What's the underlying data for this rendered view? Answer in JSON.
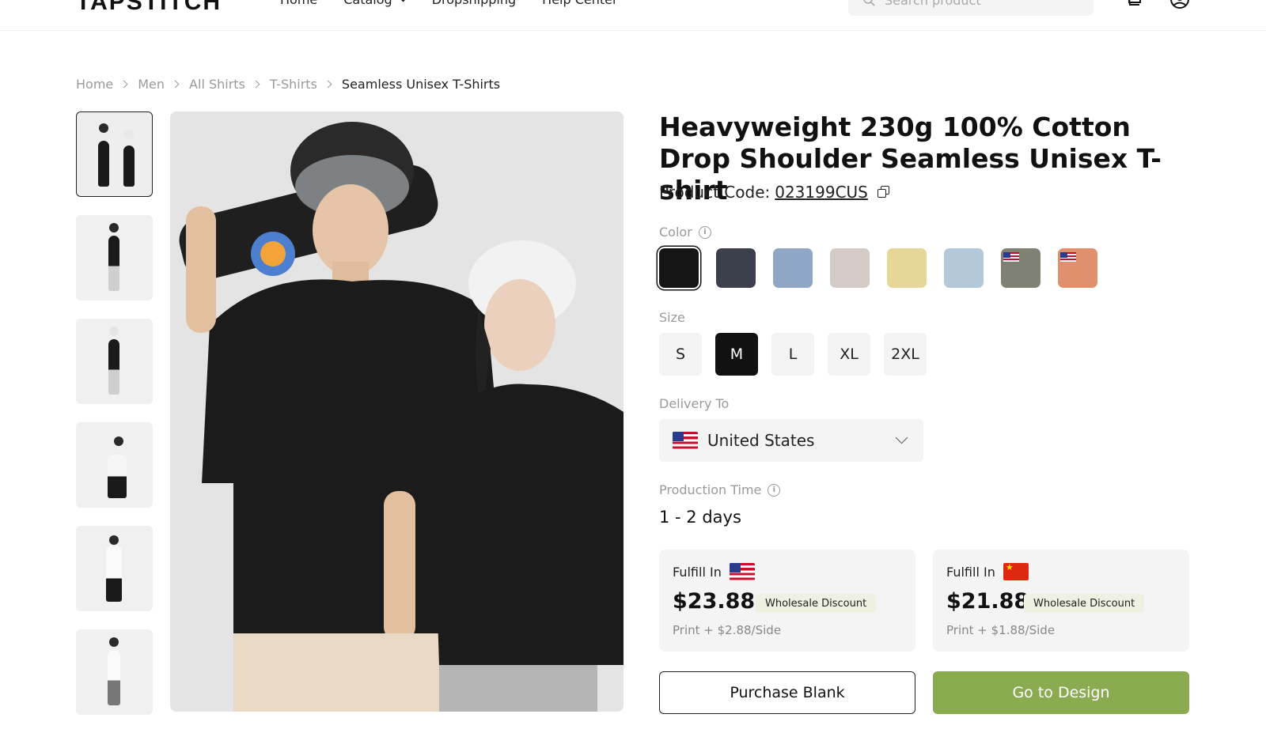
{
  "header": {
    "logo": "TAPSTITCH",
    "nav": [
      "Home",
      "Catalog",
      "Dropshipping",
      "Help Center"
    ],
    "search_placeholder": "Search product"
  },
  "breadcrumb": [
    "Home",
    "Men",
    "All Shirts",
    "T-Shirts",
    "Seamless Unisex T-Shirts"
  ],
  "product": {
    "title": "Heavyweight 230g 100% Cotton Drop Shoulder Seamless Unisex T-shirt",
    "code_label": "Product Code:",
    "code": "023199CUS",
    "color_label": "Color",
    "colors": [
      "#151515",
      "#3c3f4c",
      "#8fa6c4",
      "#d4cac6",
      "#e6d698",
      "#b3c8d8",
      "#7f8172",
      "#e0906c"
    ],
    "size_label": "Size",
    "sizes": [
      "S",
      "M",
      "L",
      "XL",
      "2XL"
    ],
    "selected_size": "M",
    "delivery_label": "Delivery To",
    "delivery_country": "United States",
    "production_label": "Production Time",
    "production_time": "1 - 2 days"
  },
  "fulfill": [
    {
      "label": "Fulfill In",
      "price": "$23.88",
      "badge": "Wholesale Discount",
      "print": "Print + $2.88/Side"
    },
    {
      "label": "Fulfill In",
      "price": "$21.88",
      "badge": "Wholesale Discount",
      "print": "Print + $1.88/Side"
    }
  ],
  "buttons": {
    "purchase": "Purchase Blank",
    "design": "Go to Design"
  }
}
